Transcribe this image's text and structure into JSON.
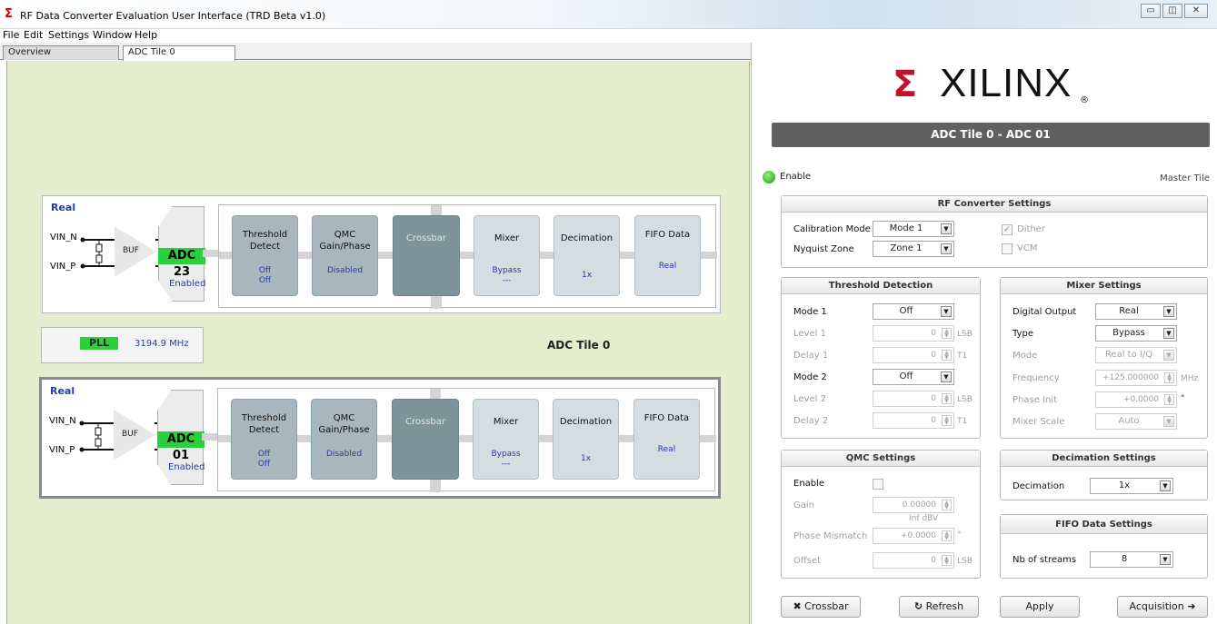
{
  "window": {
    "title": "RF Data Converter Evaluation User Interface (TRD Beta v1.0)",
    "minimize_glyph": "▭",
    "restore_glyph": "◫",
    "close_glyph": "✕"
  },
  "menu": [
    "File",
    "Edit",
    "Settings",
    "Window",
    "Help"
  ],
  "tabs": [
    "Overview",
    "ADC Tile 0"
  ],
  "tile_label": "ADC Tile 0",
  "pll": {
    "label": "PLL",
    "freq": "3194.9 MHz"
  },
  "adcs": [
    {
      "real": "Real",
      "vin_n": "VIN_N",
      "vin_p": "VIN_P",
      "buf": "BUF",
      "name": "ADC 23",
      "status": "Enabled",
      "blocks": [
        {
          "title": "Threshold Detect",
          "sub1": "Off",
          "sub2": "Off"
        },
        {
          "title": "QMC Gain/Phase",
          "sub1": "Disabled",
          "sub2": ""
        },
        {
          "title": "Crossbar",
          "sub1": "",
          "sub2": ""
        },
        {
          "title": "Mixer",
          "sub1": "Bypass",
          "sub2": "---"
        },
        {
          "title": "Decimation",
          "sub1": "1x",
          "sub2": ""
        },
        {
          "title": "FIFO Data",
          "sub1": "Real",
          "sub2": ""
        }
      ]
    },
    {
      "real": "Real",
      "vin_n": "VIN_N",
      "vin_p": "VIN_P",
      "buf": "BUF",
      "name": "ADC 01",
      "status": "Enabled",
      "blocks": [
        {
          "title": "Threshold Detect",
          "sub1": "Off",
          "sub2": "Off"
        },
        {
          "title": "QMC Gain/Phase",
          "sub1": "Disabled",
          "sub2": ""
        },
        {
          "title": "Crossbar",
          "sub1": "",
          "sub2": ""
        },
        {
          "title": "Mixer",
          "sub1": "Bypass",
          "sub2": "---"
        },
        {
          "title": "Decimation",
          "sub1": "1x",
          "sub2": ""
        },
        {
          "title": "FIFO Data",
          "sub1": "Real",
          "sub2": ""
        }
      ]
    }
  ],
  "right": {
    "logo": "XILINX",
    "logo_mark": "Σ",
    "logo_reg": "®",
    "header": "ADC Tile 0 - ADC 01",
    "enable": "Enable",
    "master": "Master Tile",
    "rf": {
      "title": "RF Converter Settings",
      "cal_label": "Calibration Mode",
      "cal_value": "Mode 1",
      "nyq_label": "Nyquist Zone",
      "nyq_value": "Zone 1",
      "dither": "Dither",
      "vcm": "VCM"
    },
    "threshold": {
      "title": "Threshold Detection",
      "mode1": "Mode 1",
      "mode1_value": "Off",
      "level1": "Level 1",
      "level1_value": "0",
      "level1_unit": "LSB",
      "delay1": "Delay 1",
      "delay1_value": "0",
      "delay1_unit": "T1",
      "mode2": "Mode 2",
      "mode2_value": "Off",
      "level2": "Level 2",
      "level2_value": "0",
      "level2_unit": "LSB",
      "delay2": "Delay 2",
      "delay2_value": "0",
      "delay2_unit": "T1"
    },
    "mixer": {
      "title": "Mixer Settings",
      "output": "Digital Output",
      "output_value": "Real",
      "type": "Type",
      "type_value": "Bypass",
      "mode": "Mode",
      "mode_value": "Real to I/Q",
      "freq": "Frequency",
      "freq_value": "+125.000000",
      "freq_unit": "MHz",
      "phase": "Phase Init",
      "phase_value": "+0.0000",
      "phase_unit": "°",
      "scale": "Mixer Scale",
      "scale_value": "Auto"
    },
    "qmc": {
      "title": "QMC Settings",
      "enable": "Enable",
      "gain": "Gain",
      "gain_value": "0.00000",
      "gain_db": "Inf dBV",
      "phase": "Phase Mismatch",
      "phase_value": "+0.0000",
      "phase_unit": "°",
      "offset": "Offset",
      "offset_value": "0",
      "offset_unit": "LSB"
    },
    "decimation": {
      "title": "Decimation Settings",
      "label": "Decimation",
      "value": "1x"
    },
    "fifo": {
      "title": "FIFO Data Settings",
      "label": "Nb of streams",
      "value": "8"
    },
    "buttons": {
      "crossbar": "Crossbar",
      "refresh": "Refresh",
      "apply": "Apply",
      "acquisition": "Acquisition"
    }
  }
}
